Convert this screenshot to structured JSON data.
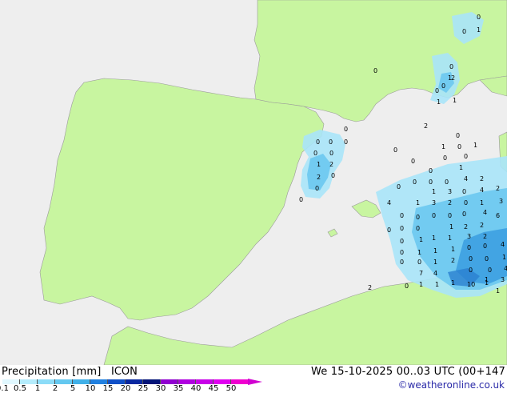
{
  "map": {
    "colors": {
      "sea": "#eeeeee",
      "land": "#c8f5a0",
      "land_border": "#999999",
      "precip_light": "#a8e4f8",
      "precip_mid": "#6cc8f0",
      "precip_strong": "#3a9ee0"
    }
  },
  "footer": {
    "title": "Precipitation [mm]",
    "model": "ICON",
    "datetime": "We 15-10-2025 00..03 UTC (00+147",
    "credit": "©weatheronline.co.uk"
  },
  "legend": {
    "ticks": [
      "0.1",
      "0.5",
      "1",
      "2",
      "5",
      "10",
      "15",
      "20",
      "25",
      "30",
      "35",
      "40",
      "45",
      "50"
    ],
    "colors": [
      "#e0f8ff",
      "#b4ecfc",
      "#8cdcf8",
      "#64c8f0",
      "#40b0e8",
      "#2080e0",
      "#1050c8",
      "#0828a0",
      "#041478",
      "#9000d0",
      "#b000e0",
      "#c800e8",
      "#e000f0",
      "#f000d0"
    ]
  },
  "precip_labels": [
    "0",
    "0",
    "1",
    "0",
    "0",
    "1",
    "2",
    "0",
    "0",
    "1",
    "1",
    "0",
    "0",
    "0",
    "0",
    "0",
    "0",
    "1",
    "2",
    "2",
    "0",
    "0",
    "1",
    "0",
    "1",
    "0",
    "0",
    "0",
    "1",
    "0",
    "2",
    "0",
    "0",
    "0",
    "0",
    "4",
    "2",
    "0",
    "2",
    "0",
    "1",
    "3",
    "0",
    "0",
    "4",
    "3",
    "1",
    "4",
    "1",
    "3",
    "2",
    "0",
    "0",
    "0",
    "0",
    "0",
    "4",
    "6",
    "0",
    "0",
    "0",
    "0",
    "2",
    "2",
    "1",
    "2",
    "3",
    "1",
    "1",
    "1",
    "0",
    "4",
    "0",
    "0",
    "1",
    "0",
    "1",
    "1",
    "1",
    "0",
    "0",
    "0",
    "4",
    "0",
    "0",
    "1",
    "2",
    "0",
    "1",
    "3",
    "7",
    "4",
    "1",
    "2",
    "0",
    "1",
    "10",
    "1",
    "1",
    "1",
    "0",
    "1",
    "2",
    "0"
  ]
}
